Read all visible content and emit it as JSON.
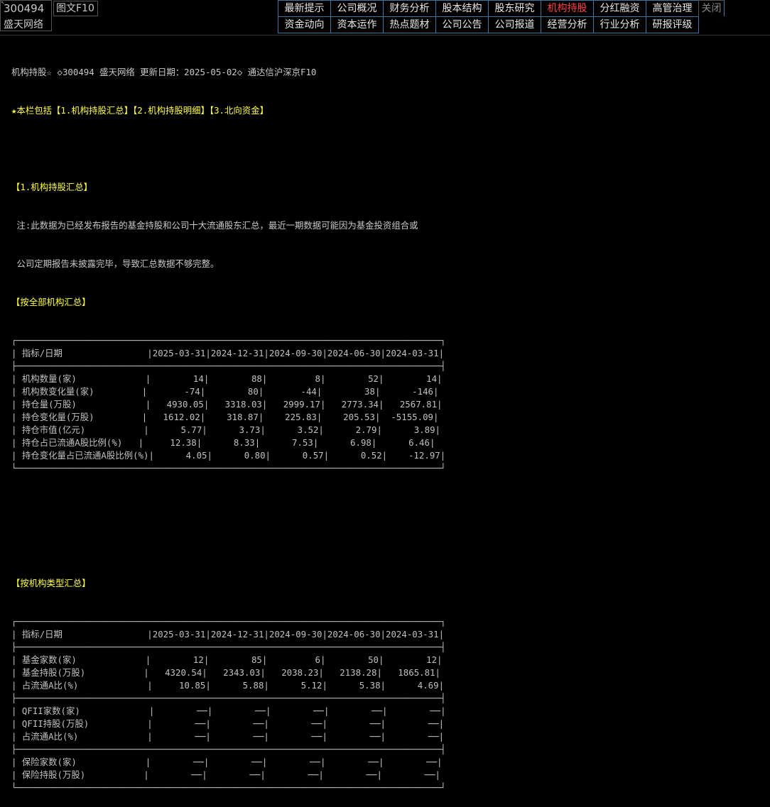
{
  "ticker": {
    "code": "300494",
    "name": "盛天网络",
    "f10_label": "图文F10"
  },
  "nav": {
    "row1": [
      "最新提示",
      "公司概况",
      "财务分析",
      "股本结构",
      "股东研究",
      "机构持股",
      "分红融资",
      "高管治理",
      "关闭"
    ],
    "row2": [
      "资金动向",
      "资本运作",
      "热点题材",
      "公司公告",
      "公司报道",
      "经营分析",
      "行业分析",
      "研报评级"
    ],
    "active": "机构持股"
  },
  "header": {
    "title_line": "机构持股☆ ◇300494 盛天网络 更新日期：2025-05-02◇ 通达信沪深京F10",
    "sections_line": "★本栏包括【1.机构持股汇总】【2.机构持股明细】【3.北向资金】"
  },
  "section1": {
    "title": "【1.机构持股汇总】",
    "note_line1": " 注:此数据为已经发布报告的基金持股和公司十大流通股东汇总，最近一期数据可能因为基金投资组合或",
    "note_line2": " 公司定期报告未披露完毕，导致汇总数据不够完整。"
  },
  "table_all": {
    "title": "【按全部机构汇总】",
    "header_label": "指标/日期",
    "dates": [
      "2025-03-31",
      "2024-12-31",
      "2024-09-30",
      "2024-06-30",
      "2024-03-31"
    ],
    "rows": [
      {
        "label": "机构数量(家)",
        "values": [
          "14",
          "88",
          "8",
          "52",
          "14"
        ]
      },
      {
        "label": "机构数变化量(家)",
        "values": [
          "-74",
          "80",
          "-44",
          "38",
          "-146"
        ]
      },
      {
        "label": "持仓量(万股)",
        "values": [
          "4930.05",
          "3318.03",
          "2999.17",
          "2773.34",
          "2567.81"
        ]
      },
      {
        "label": "持仓变化量(万股)",
        "values": [
          "1612.02",
          "318.87",
          "225.83",
          "205.53",
          "-5155.09"
        ]
      },
      {
        "label": "持仓市值(亿元)",
        "values": [
          "5.77",
          "3.73",
          "3.52",
          "2.79",
          "3.89"
        ]
      },
      {
        "label": "持仓占已流通A股比例(%)",
        "values": [
          "12.38",
          "8.33",
          "7.53",
          "6.98",
          "6.46"
        ]
      },
      {
        "label": "持仓变化量占已流通A股比例(%)",
        "values": [
          "4.05",
          "0.80",
          "0.57",
          "0.52",
          "-12.97"
        ]
      }
    ]
  },
  "table_type": {
    "title": "【按机构类型汇总】",
    "header_label": "指标/日期",
    "dates": [
      "2025-03-31",
      "2024-12-31",
      "2024-09-30",
      "2024-06-30",
      "2024-03-31"
    ],
    "groups": [
      [
        {
          "label": "基金家数(家)",
          "values": [
            "12",
            "85",
            "6",
            "50",
            "12"
          ]
        },
        {
          "label": "基金持股(万股)",
          "values": [
            "4320.54",
            "2343.03",
            "2038.23",
            "2138.28",
            "1865.81"
          ]
        },
        {
          "label": "占流通A比(%)",
          "values": [
            "10.85",
            "5.88",
            "5.12",
            "5.38",
            "4.69"
          ]
        }
      ],
      [
        {
          "label": "QFII家数(家)",
          "values": [
            "──",
            "──",
            "──",
            "──",
            "──"
          ]
        },
        {
          "label": "QFII持股(万股)",
          "values": [
            "──",
            "──",
            "──",
            "──",
            "──"
          ]
        },
        {
          "label": "占流通A比(%)",
          "values": [
            "──",
            "──",
            "──",
            "──",
            "──"
          ]
        }
      ],
      [
        {
          "label": "保险家数(家)",
          "values": [
            "──",
            "──",
            "──",
            "──",
            "──"
          ]
        },
        {
          "label": "保险持股(万股)",
          "values": [
            "──",
            "──",
            "──",
            "──",
            "──"
          ]
        }
      ]
    ]
  }
}
